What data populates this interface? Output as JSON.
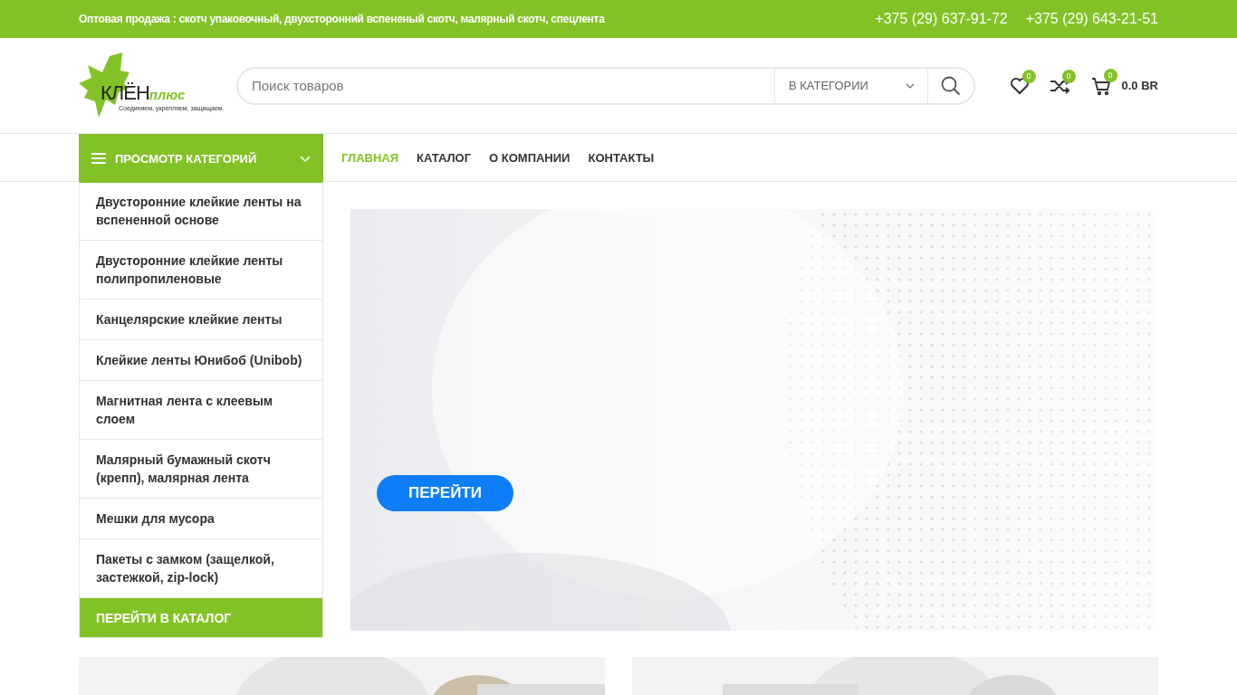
{
  "top_bar": {
    "text": "Оптовая продажа : скотч упаковочный, двухсторонний вспененый скотч, малярный скотч, спецлента",
    "phones": [
      "+375 (29) 637-91-72",
      "+375 (29) 643-21-51"
    ]
  },
  "logo": {
    "name_first": "КЛЁН",
    "name_second": "плюс",
    "tagline": "Соединяем, укрепляем, защищаем."
  },
  "search": {
    "placeholder": "Поиск товаров",
    "category": "В КАТЕГОРИИ"
  },
  "header_icons": [
    {
      "kind": "wishlist",
      "count": "0"
    },
    {
      "kind": "compare",
      "count": "0"
    },
    {
      "kind": "cart",
      "count": "0",
      "total": "0.0 BR"
    }
  ],
  "categories_button": "ПРОСМОТР КАТЕГОРИЙ",
  "nav": [
    {
      "label": "ГЛАВНАЯ",
      "selected": true
    },
    {
      "label": "КАТАЛОГ",
      "selected": false
    },
    {
      "label": "О КОМПАНИИ",
      "selected": false
    },
    {
      "label": "КОНТАКТЫ",
      "selected": false
    }
  ],
  "sidebar": {
    "items": [
      "Двусторонние клейкие ленты на вспененной основе",
      "Двусторонние клейкие ленты полипропиленовые",
      "Канцелярские клейкие ленты",
      "Клейкие ленты Юнибоб (Unibob)",
      "Магнитная лента с клеевым слоем",
      "Малярный бумажный скотч (крепп), малярная лента",
      "Мешки для мусора",
      "Пакеты с замком (защелкой, застежкой, zip-lock)"
    ],
    "footer_link": "ПЕРЕЙТИ В КАТАЛОГ"
  },
  "banner": {
    "kind": "picture",
    "button": "ПЕРЕЙТИ"
  }
}
